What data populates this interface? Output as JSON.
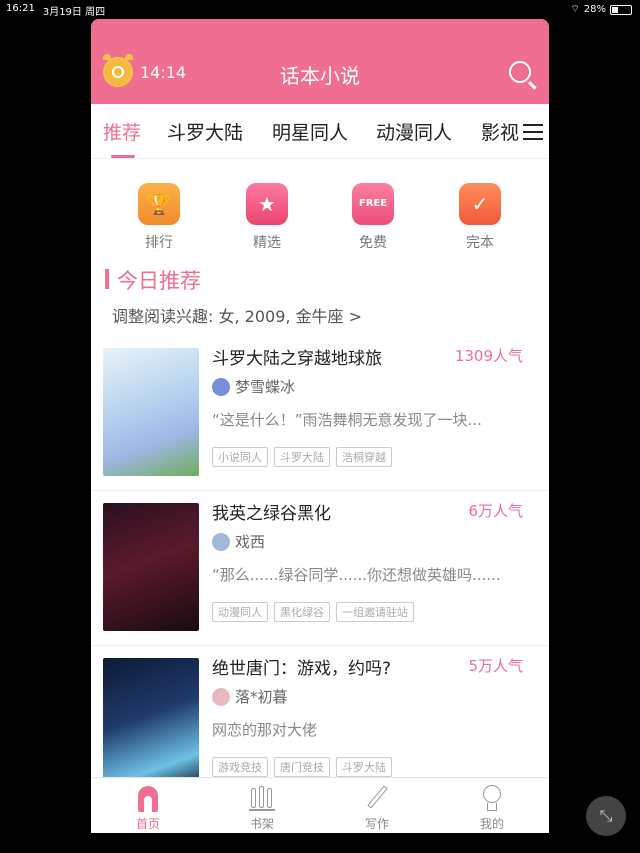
{
  "status": {
    "time": "16:21",
    "date": "3月19日 周四",
    "battery": "28%"
  },
  "header": {
    "timer": "14:14",
    "title": "话本小说"
  },
  "tabs": [
    "推荐",
    "斗罗大陆",
    "明星同人",
    "动漫同人",
    "影视"
  ],
  "quick": [
    {
      "label": "排行",
      "icon": "trophy-icon"
    },
    {
      "label": "精选",
      "icon": "star-icon"
    },
    {
      "label": "免费",
      "icon": "free-icon",
      "badge": "FREE"
    },
    {
      "label": "完本",
      "icon": "check-icon"
    }
  ],
  "section": {
    "title": "今日推荐",
    "interest": "调整阅读兴趣: 女, 2009, 金牛座 >"
  },
  "books": [
    {
      "title": "斗罗大陆之穿越地球旅",
      "popularity": "1309人气",
      "author": "梦雪蝶冰",
      "desc": "“这是什么！”雨浩舞桐无意发现了一块...",
      "tags": [
        "小说同人",
        "斗罗大陆",
        "浩桐穿越"
      ]
    },
    {
      "title": "我英之绿谷黑化",
      "popularity": "6万人气",
      "author": "戏西",
      "desc": "“那么......绿谷同学......你还想做英雄吗......",
      "tags": [
        "动漫同人",
        "黑化绿谷",
        "一组邀请驻站"
      ]
    },
    {
      "title": "绝世唐门：游戏，约吗?",
      "popularity": "5万人气",
      "author": "落*初暮",
      "desc": "网恋的那对大佬",
      "tags": [
        "游戏竞技",
        "唐门竞技",
        "斗罗大陆"
      ]
    }
  ],
  "bottom_nav": [
    "首页",
    "书架",
    "写作",
    "我的"
  ],
  "colors": {
    "accent": "#f06f90",
    "header": "#f06f90"
  }
}
